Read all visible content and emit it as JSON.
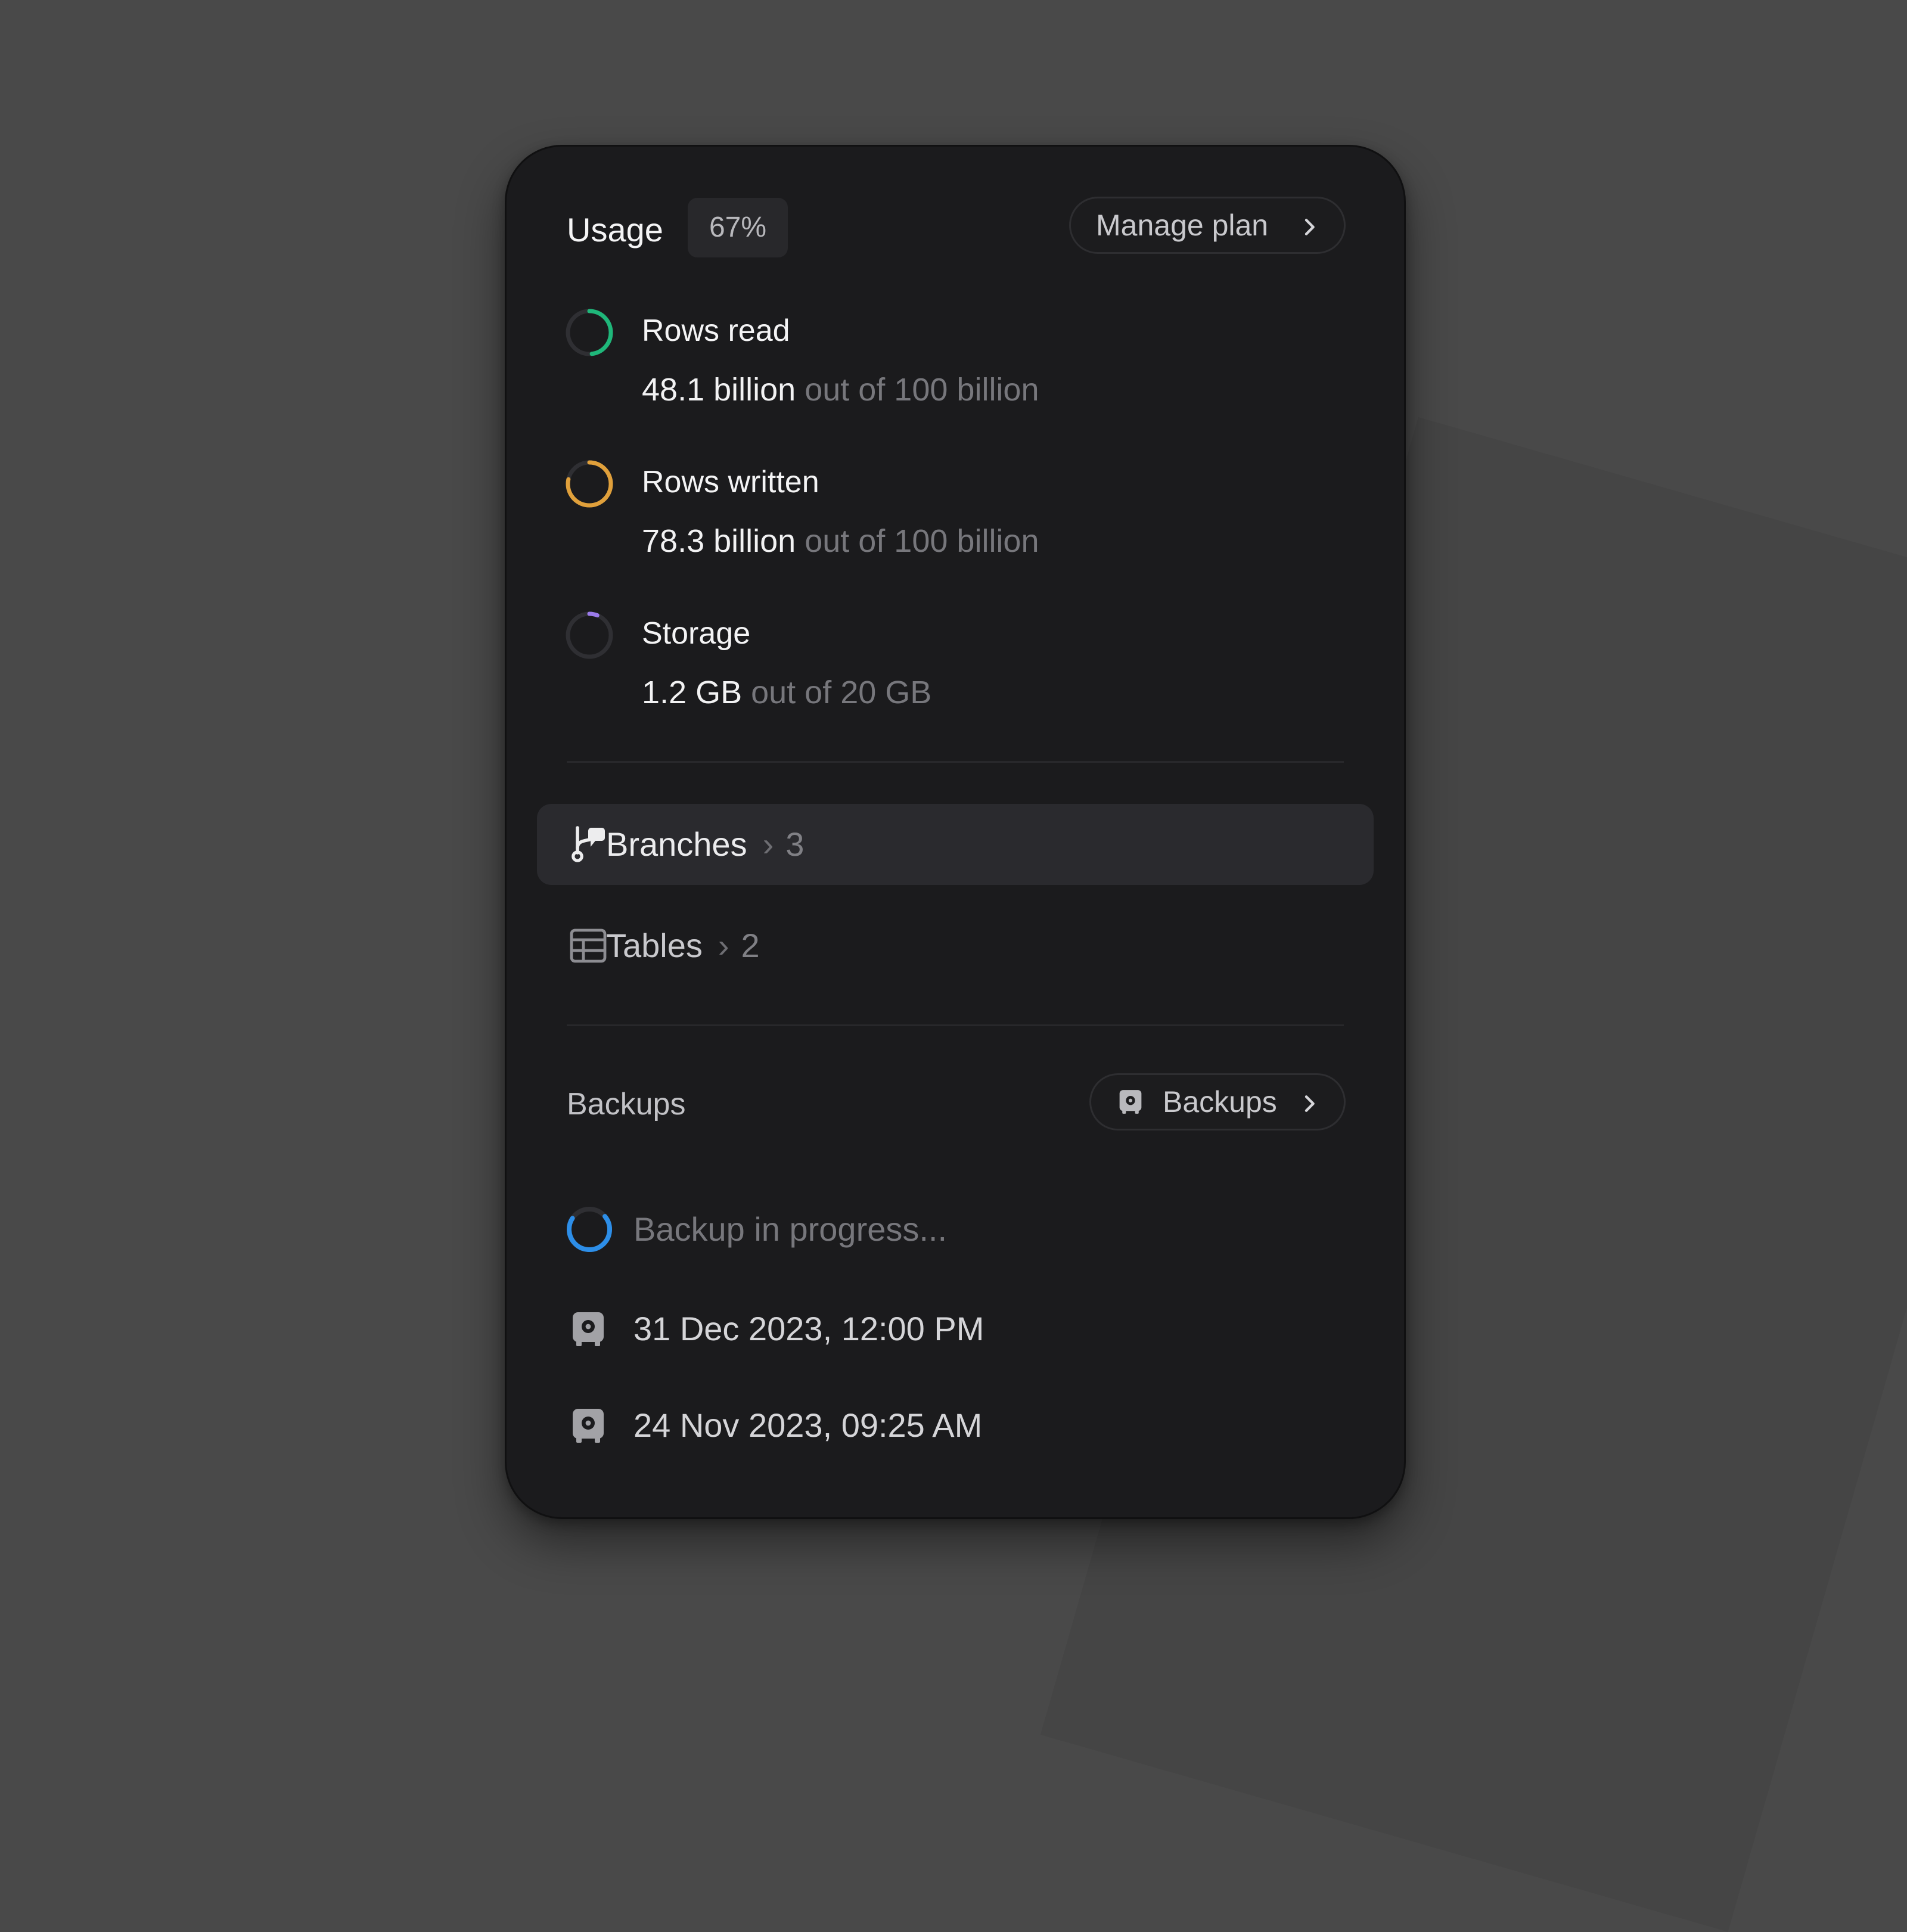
{
  "usage": {
    "title": "Usage",
    "percent": "67%",
    "manage_label": "Manage plan"
  },
  "metrics": [
    {
      "label": "Rows read",
      "value": "48.1 billion",
      "limit": "out of 100 billion",
      "fraction": 0.481,
      "color": "#1fb77a"
    },
    {
      "label": "Rows written",
      "value": "78.3 billion",
      "limit": "out of 100 billion",
      "fraction": 0.783,
      "color": "#e0a03b"
    },
    {
      "label": "Storage",
      "value": "1.2 GB",
      "limit": "out of 20 GB",
      "fraction": 0.06,
      "color": "#9b7bea"
    }
  ],
  "nav": {
    "branches": {
      "label": "Branches",
      "count": "3",
      "active": true
    },
    "tables": {
      "label": "Tables",
      "count": "2",
      "active": false
    }
  },
  "backups": {
    "title": "Backups",
    "button_label": "Backups",
    "in_progress": "Backup in progress...",
    "items": [
      "31 Dec 2023, 12:00 PM",
      "24 Nov 2023, 09:25 AM"
    ]
  },
  "colors": {
    "card_background": "#1b1b1d",
    "active_row": "#2a2a2e",
    "progress_blue": "#2d8ee8"
  },
  "icons": [
    "chevron-right-icon",
    "branch-icon",
    "table-icon",
    "safe-icon",
    "spinner-icon"
  ]
}
